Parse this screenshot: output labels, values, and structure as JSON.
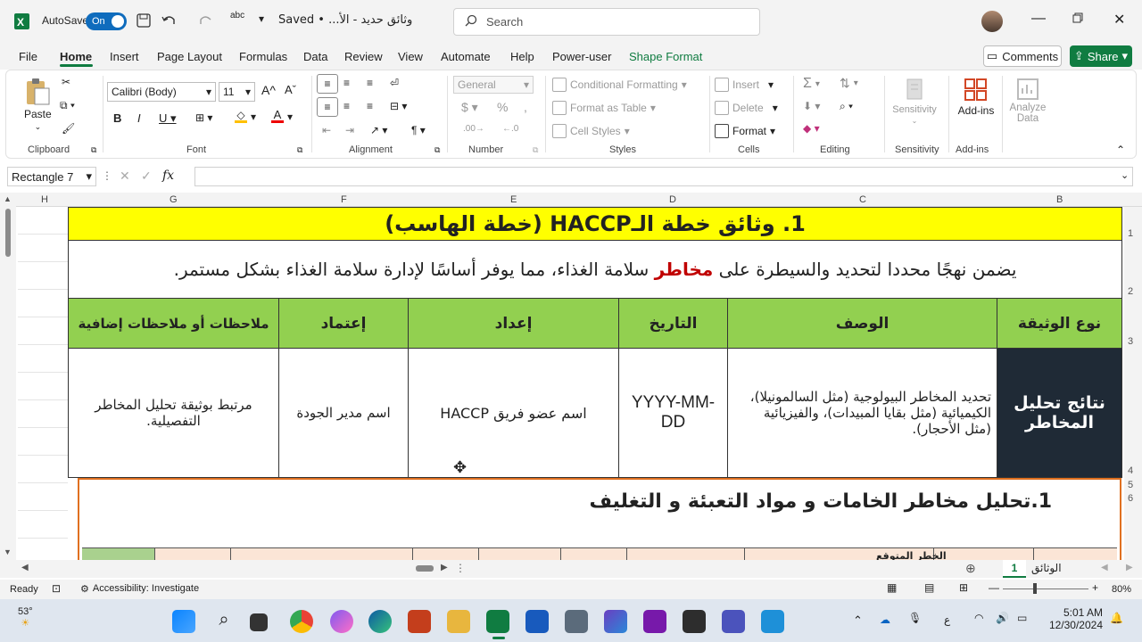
{
  "titlebar": {
    "autosave_label": "AutoSave",
    "toggle_label": "On",
    "doc_title": "وثائق حديد - الأ... • Saved",
    "search_placeholder": "Search"
  },
  "menu": {
    "items": [
      "File",
      "Home",
      "Insert",
      "Page Layout",
      "Formulas",
      "Data",
      "Review",
      "View",
      "Automate",
      "Help",
      "Power-user",
      "Shape Format"
    ],
    "comments": "Comments",
    "share": "Share"
  },
  "ribbon": {
    "clipboard": {
      "paste": "Paste",
      "label": "Clipboard"
    },
    "font": {
      "name": "Calibri (Body)",
      "size": "11",
      "label": "Font"
    },
    "alignment": {
      "label": "Alignment"
    },
    "number": {
      "format": "General",
      "label": "Number"
    },
    "styles": {
      "conditional": "Conditional Formatting",
      "table": "Format as Table",
      "cell": "Cell Styles",
      "label": "Styles"
    },
    "cells": {
      "insert": "Insert",
      "delete": "Delete",
      "format": "Format",
      "label": "Cells"
    },
    "editing": {
      "label": "Editing"
    },
    "sensitivity": {
      "btn": "Sensitivity",
      "label": "Sensitivity"
    },
    "addins": {
      "btn": "Add-ins",
      "label": "Add-ins"
    },
    "analyze": {
      "btn1": "Analyze",
      "btn2": "Data"
    }
  },
  "formula": {
    "namebox": "Rectangle 7",
    "fx": "fx"
  },
  "columns": [
    "H",
    "G",
    "F",
    "E",
    "D",
    "C",
    "B"
  ],
  "rows": [
    "1",
    "2",
    "3",
    "4",
    "5",
    "6"
  ],
  "sheet": {
    "title": "1. وثائق خطة الـHACCP (خطة الهاسب)",
    "intro_before": "يضمن نهجًا محددا لتحديد والسيطرة على ",
    "intro_highlight": "مخاطر",
    "intro_after": " سلامة الغذاء، مما يوفر أساسًا لإدارة سلامة الغذاء بشكل مستمر.",
    "headers": [
      "نوع الوثيقة",
      "الوصف",
      "التاريخ",
      "إعداد",
      "إعتماد",
      "ملاحظات أو ملاحظات إضافية"
    ],
    "row": [
      "نتائج تحليل المخاطر",
      "تحديد المخاطر البيولوجية (مثل السالمونيلا)، الكيميائية (مثل بقايا المبيدات)، والفيزيائية (مثل الأحجار).",
      "YYYY-MM-DD",
      "اسم عضو فريق HACCP",
      "اسم مدير الجودة",
      "مرتبط بوثيقة تحليل المخاطر التفصيلية."
    ],
    "shape_title": "1.تحليل مخاطر الخامات و مواد التعبئة و التغليف",
    "shape_sub": "الخطر المتوقع"
  },
  "tabs": {
    "sheet1": "1",
    "sheet2": "الوثائق"
  },
  "status": {
    "ready": "Ready",
    "access": "Accessibility: Investigate",
    "zoom": "80%"
  },
  "taskbar": {
    "temp": "53°",
    "time": "5:01 AM",
    "date": "12/30/2024",
    "lang": "ع"
  },
  "colors": {
    "yellow": "#ffff00",
    "green": "#92d050",
    "dark": "#1f2a36",
    "red": "#c00000",
    "orange": "#e07020",
    "excel": "#107c41"
  }
}
